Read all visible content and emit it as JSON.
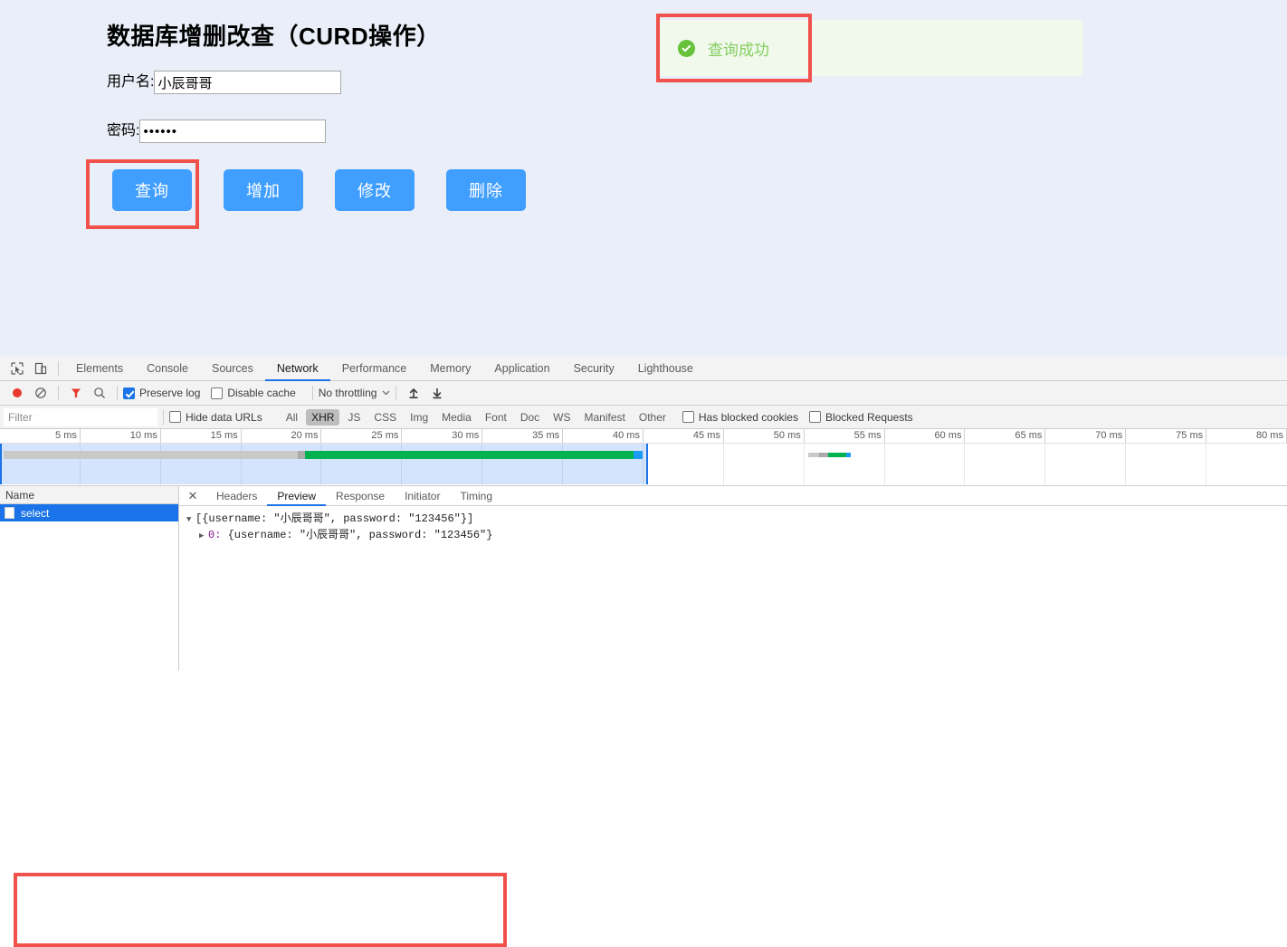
{
  "page": {
    "title": "数据库增删改查（CURD操作）",
    "form": {
      "username_label": "用户名:",
      "username_value": "小辰哥哥",
      "username_placeholder": "",
      "password_label": "密码:",
      "password_value": "••••••",
      "password_placeholder": ""
    },
    "buttons": [
      {
        "name": "query",
        "label": "查询"
      },
      {
        "name": "insert",
        "label": "增加"
      },
      {
        "name": "update",
        "label": "修改"
      },
      {
        "name": "delete",
        "label": "删除"
      }
    ],
    "alert": {
      "text": "查询成功",
      "icon": "check-circle-icon",
      "bg_color": "#f0f9eb",
      "icon_color": "#67c23a",
      "text_color": "#85ce61"
    },
    "colors": {
      "page_bg": "#eaeef8",
      "button_blue": "#409eff",
      "annotation_red": "#f0524b"
    }
  },
  "devtools": {
    "main_tabs": [
      {
        "label": "Elements",
        "active": false
      },
      {
        "label": "Console",
        "active": false
      },
      {
        "label": "Sources",
        "active": false
      },
      {
        "label": "Network",
        "active": true
      },
      {
        "label": "Performance",
        "active": false
      },
      {
        "label": "Memory",
        "active": false
      },
      {
        "label": "Application",
        "active": false
      },
      {
        "label": "Security",
        "active": false
      },
      {
        "label": "Lighthouse",
        "active": false
      }
    ],
    "toolbar": {
      "preserve_log_label": "Preserve log",
      "preserve_log_checked": true,
      "disable_cache_label": "Disable cache",
      "disable_cache_checked": false,
      "throttling_value": "No throttling"
    },
    "filter": {
      "placeholder": "Filter",
      "value": "",
      "hide_data_urls_label": "Hide data URLs",
      "hide_data_urls_checked": false,
      "types": [
        {
          "label": "All",
          "active": false
        },
        {
          "label": "XHR",
          "active": true
        },
        {
          "label": "JS",
          "active": false
        },
        {
          "label": "CSS",
          "active": false
        },
        {
          "label": "Img",
          "active": false
        },
        {
          "label": "Media",
          "active": false
        },
        {
          "label": "Font",
          "active": false
        },
        {
          "label": "Doc",
          "active": false
        },
        {
          "label": "WS",
          "active": false
        },
        {
          "label": "Manifest",
          "active": false
        },
        {
          "label": "Other",
          "active": false
        }
      ],
      "has_blocked_cookies_label": "Has blocked cookies",
      "has_blocked_cookies_checked": false,
      "blocked_requests_label": "Blocked Requests",
      "blocked_requests_checked": false
    },
    "timeline": {
      "ticks": [
        "5 ms",
        "10 ms",
        "15 ms",
        "20 ms",
        "25 ms",
        "30 ms",
        "35 ms",
        "40 ms",
        "45 ms",
        "50 ms",
        "55 ms",
        "60 ms",
        "65 ms",
        "70 ms",
        "75 ms",
        "80 ms"
      ],
      "max_ms": 80,
      "selection_start_ms": 0,
      "selection_end_ms": 40
    },
    "requests": {
      "column_header": "Name",
      "rows": [
        {
          "name": "select",
          "selected": true
        }
      ]
    },
    "drawer": {
      "close_label": "✕",
      "tabs": [
        {
          "label": "Headers",
          "active": false
        },
        {
          "label": "Preview",
          "active": true
        },
        {
          "label": "Response",
          "active": false
        },
        {
          "label": "Initiator",
          "active": false
        },
        {
          "label": "Timing",
          "active": false
        }
      ],
      "preview": {
        "line1": "[{username: \"小辰哥哥\", password: \"123456\"}]",
        "line2_index": "0:",
        "line2_body": "{username: \"小辰哥哥\", password: \"123456\"}"
      }
    }
  }
}
